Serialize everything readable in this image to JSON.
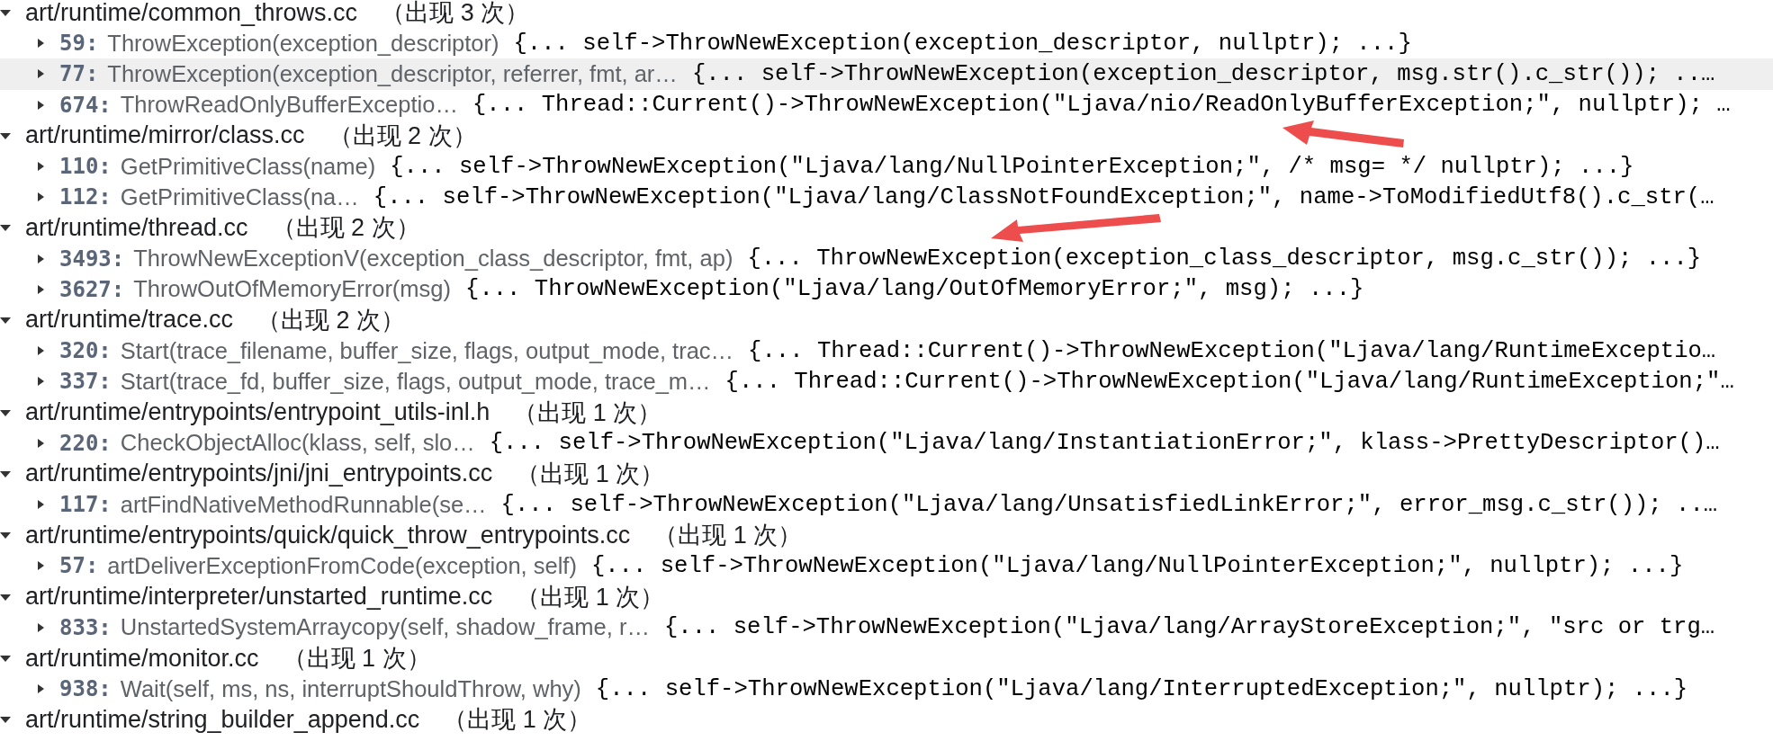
{
  "groups": [
    {
      "path": "art/runtime/common_throws.cc",
      "count": "（出现 3 次）",
      "expanded": true,
      "matches": [
        {
          "line": "59:",
          "function": "ThrowException(exception_descriptor)",
          "snippet": "{... self->ThrowNewException(exception_descriptor, nullptr); ...}",
          "expanded": false,
          "selected": false
        },
        {
          "line": "77:",
          "function": "ThrowException(exception_descriptor, referrer, fmt, ar…",
          "snippet": "{... self->ThrowNewException(exception_descriptor, msg.str().c_str()); ..…",
          "expanded": false,
          "selected": true
        },
        {
          "line": "674:",
          "function": "ThrowReadOnlyBufferExceptio…",
          "snippet": "{... Thread::Current()->ThrowNewException(\"Ljava/nio/ReadOnlyBufferException;\", nullptr); …",
          "expanded": false,
          "selected": false
        }
      ]
    },
    {
      "path": "art/runtime/mirror/class.cc",
      "count": "（出现 2 次）",
      "expanded": true,
      "matches": [
        {
          "line": "110:",
          "function": "GetPrimitiveClass(name)",
          "snippet": "{... self->ThrowNewException(\"Ljava/lang/NullPointerException;\", /* msg= */ nullptr); ...}",
          "expanded": false,
          "selected": false
        },
        {
          "line": "112:",
          "function": "GetPrimitiveClass(na…",
          "snippet": "{... self->ThrowNewException(\"Ljava/lang/ClassNotFoundException;\", name->ToModifiedUtf8().c_str(…",
          "expanded": false,
          "selected": false
        }
      ]
    },
    {
      "path": "art/runtime/thread.cc",
      "count": "（出现 2 次）",
      "expanded": true,
      "matches": [
        {
          "line": "3493:",
          "function": "ThrowNewExceptionV(exception_class_descriptor, fmt, ap)",
          "snippet": "{... ThrowNewException(exception_class_descriptor, msg.c_str()); ...}",
          "expanded": false,
          "selected": false
        },
        {
          "line": "3627:",
          "function": "ThrowOutOfMemoryError(msg)",
          "snippet": "{... ThrowNewException(\"Ljava/lang/OutOfMemoryError;\", msg); ...}",
          "expanded": false,
          "selected": false
        }
      ]
    },
    {
      "path": "art/runtime/trace.cc",
      "count": "（出现 2 次）",
      "expanded": true,
      "matches": [
        {
          "line": "320:",
          "function": "Start(trace_filename, buffer_size, flags, output_mode, trac…",
          "snippet": "{... Thread::Current()->ThrowNewException(\"Ljava/lang/RuntimeExceptio…",
          "expanded": false,
          "selected": false
        },
        {
          "line": "337:",
          "function": "Start(trace_fd, buffer_size, flags, output_mode, trace_m…",
          "snippet": "{... Thread::Current()->ThrowNewException(\"Ljava/lang/RuntimeException;\"…",
          "expanded": false,
          "selected": false
        }
      ]
    },
    {
      "path": "art/runtime/entrypoints/entrypoint_utils-inl.h",
      "count": "（出现 1 次）",
      "expanded": true,
      "matches": [
        {
          "line": "220:",
          "function": "CheckObjectAlloc(klass, self, slo…",
          "snippet": "{... self->ThrowNewException(\"Ljava/lang/InstantiationError;\", klass->PrettyDescriptor()…",
          "expanded": false,
          "selected": false
        }
      ]
    },
    {
      "path": "art/runtime/entrypoints/jni/jni_entrypoints.cc",
      "count": "（出现 1 次）",
      "expanded": true,
      "matches": [
        {
          "line": "117:",
          "function": "artFindNativeMethodRunnable(se…",
          "snippet": "{... self->ThrowNewException(\"Ljava/lang/UnsatisfiedLinkError;\", error_msg.c_str()); ..…",
          "expanded": false,
          "selected": false
        }
      ]
    },
    {
      "path": "art/runtime/entrypoints/quick/quick_throw_entrypoints.cc",
      "count": "（出现 1 次）",
      "expanded": true,
      "matches": [
        {
          "line": "57:",
          "function": "artDeliverExceptionFromCode(exception, self)",
          "snippet": "{... self->ThrowNewException(\"Ljava/lang/NullPointerException;\", nullptr); ...}",
          "expanded": false,
          "selected": false
        }
      ]
    },
    {
      "path": "art/runtime/interpreter/unstarted_runtime.cc",
      "count": "（出现 1 次）",
      "expanded": true,
      "matches": [
        {
          "line": "833:",
          "function": "UnstartedSystemArraycopy(self, shadow_frame, r…",
          "snippet": "{... self->ThrowNewException(\"Ljava/lang/ArrayStoreException;\", \"src or trg…",
          "expanded": false,
          "selected": false
        }
      ]
    },
    {
      "path": "art/runtime/monitor.cc",
      "count": "（出现 1 次）",
      "expanded": true,
      "matches": [
        {
          "line": "938:",
          "function": "Wait(self, ms, ns, interruptShouldThrow, why)",
          "snippet": "{... self->ThrowNewException(\"Ljava/lang/InterruptedException;\", nullptr); ...}",
          "expanded": false,
          "selected": false
        }
      ]
    },
    {
      "path": "art/runtime/string_builder_append.cc",
      "count": "（出现 1 次）",
      "expanded": true
    }
  ],
  "annotations": [
    {
      "kind": "arrow"
    },
    {
      "kind": "arrow"
    }
  ]
}
